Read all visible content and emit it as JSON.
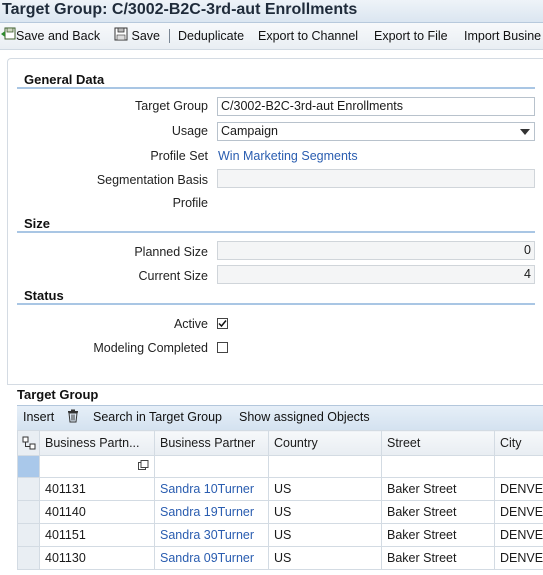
{
  "window": {
    "title": "Target Group: C/3002-B2C-3rd-aut Enrollments"
  },
  "toolbar": {
    "save_and_back": "Save and Back",
    "save": "Save",
    "deduplicate": "Deduplicate",
    "export_channel": "Export to Channel",
    "export_file": "Export to File",
    "import_business": "Import Busine"
  },
  "general": {
    "heading": "General Data",
    "target_group_label": "Target Group",
    "target_group_value": "C/3002-B2C-3rd-aut Enrollments",
    "usage_label": "Usage",
    "usage_value": "Campaign",
    "profile_set_label": "Profile Set",
    "profile_set_value": "Win Marketing Segments",
    "segmentation_basis_label": "Segmentation Basis",
    "segmentation_basis_value": "",
    "profile_label": "Profile"
  },
  "size": {
    "heading": "Size",
    "planned_label": "Planned Size",
    "planned_value": "0",
    "current_label": "Current Size",
    "current_value": "4"
  },
  "status": {
    "heading": "Status",
    "active_label": "Active",
    "active_checked": true,
    "modeling_label": "Modeling Completed",
    "modeling_checked": false
  },
  "table": {
    "title": "Target Group",
    "actions": {
      "insert": "Insert",
      "search": "Search in Target Group",
      "show_assigned": "Show assigned Objects"
    },
    "columns": [
      "Business Partn...",
      "Business Partner",
      "Country",
      "Street",
      "City"
    ],
    "rows": [
      [
        "401131",
        "Sandra 10Turner",
        "US",
        "Baker Street",
        "DENVE"
      ],
      [
        "401140",
        "Sandra 19Turner",
        "US",
        "Baker Street",
        "DENVE"
      ],
      [
        "401151",
        "Sandra 30Turner",
        "US",
        "Baker Street",
        "DENVE"
      ],
      [
        "401130",
        "Sandra 09Turner",
        "US",
        "Baker Street",
        "DENVE"
      ]
    ]
  },
  "colors": {
    "accent": "#a9c6e4",
    "link": "#2a5db0",
    "title_bg": "#dbe6f1"
  }
}
